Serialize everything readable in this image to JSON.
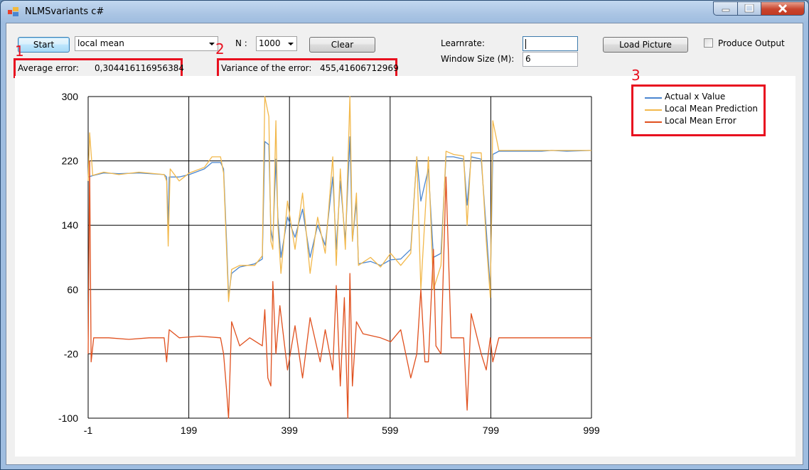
{
  "window": {
    "title": "NLMSvariants c#"
  },
  "toolbar": {
    "start_label": "Start",
    "mode_value": "local mean",
    "n_label": "N :",
    "n_value": "1000",
    "clear_label": "Clear",
    "learnrate_label": "Learnrate:",
    "learnrate_value": "",
    "window_size_label": "Window Size (M):",
    "window_size_value": "6",
    "load_picture_label": "Load Picture",
    "produce_output_label": "Produce Output",
    "produce_output_checked": false
  },
  "stats": {
    "avg_error_label": "Average error:",
    "avg_error_value": "0,304416116956384",
    "variance_label": "Variance of the error:",
    "variance_value": "455,41606712969"
  },
  "annotations": [
    "1",
    "2",
    "3"
  ],
  "colors": {
    "actual": "#4a86d0",
    "prediction": "#f2b84b",
    "error": "#e0501e",
    "highlight": "#e8101f"
  },
  "chart_data": {
    "type": "line",
    "title": "",
    "xlabel": "",
    "ylabel": "",
    "xlim": [
      -1,
      999
    ],
    "ylim": [
      -100,
      300
    ],
    "x_ticks": [
      "-1",
      "199",
      "399",
      "599",
      "799",
      "999"
    ],
    "y_ticks": [
      "300",
      "220",
      "140",
      "60",
      "-20",
      "-100"
    ],
    "grid": true,
    "legend_position": "right",
    "series": [
      {
        "name": "Actual x Value",
        "points": [
          [
            -1,
            200
          ],
          [
            10,
            202
          ],
          [
            30,
            205
          ],
          [
            60,
            204
          ],
          [
            100,
            205
          ],
          [
            150,
            203
          ],
          [
            155,
            200
          ],
          [
            158,
            140
          ],
          [
            160,
            200
          ],
          [
            180,
            200
          ],
          [
            200,
            203
          ],
          [
            230,
            210
          ],
          [
            245,
            218
          ],
          [
            262,
            218
          ],
          [
            268,
            210
          ],
          [
            274,
            120
          ],
          [
            278,
            52
          ],
          [
            284,
            80
          ],
          [
            300,
            88
          ],
          [
            330,
            92
          ],
          [
            345,
            98
          ],
          [
            350,
            244
          ],
          [
            358,
            240
          ],
          [
            362,
            135
          ],
          [
            366,
            120
          ],
          [
            372,
            222
          ],
          [
            376,
            150
          ],
          [
            382,
            100
          ],
          [
            395,
            150
          ],
          [
            410,
            125
          ],
          [
            425,
            160
          ],
          [
            440,
            100
          ],
          [
            455,
            140
          ],
          [
            470,
            115
          ],
          [
            485,
            200
          ],
          [
            492,
            110
          ],
          [
            500,
            195
          ],
          [
            510,
            120
          ],
          [
            519,
            250
          ],
          [
            524,
            120
          ],
          [
            532,
            170
          ],
          [
            536,
            92
          ],
          [
            560,
            95
          ],
          [
            580,
            90
          ],
          [
            600,
            97
          ],
          [
            620,
            98
          ],
          [
            640,
            110
          ],
          [
            652,
            225
          ],
          [
            660,
            170
          ],
          [
            675,
            210
          ],
          [
            685,
            100
          ],
          [
            700,
            105
          ],
          [
            710,
            225
          ],
          [
            725,
            225
          ],
          [
            745,
            222
          ],
          [
            752,
            165
          ],
          [
            760,
            225
          ],
          [
            780,
            222
          ],
          [
            790,
            135
          ],
          [
            798,
            60
          ],
          [
            803,
            228
          ],
          [
            815,
            232
          ],
          [
            830,
            232
          ],
          [
            850,
            232
          ],
          [
            870,
            232
          ],
          [
            880,
            232
          ],
          [
            900,
            232
          ],
          [
            920,
            233
          ],
          [
            950,
            232
          ],
          [
            999,
            233
          ]
        ]
      },
      {
        "name": "Local Mean Prediction",
        "points": [
          [
            -1,
            195
          ],
          [
            2,
            255
          ],
          [
            8,
            202
          ],
          [
            30,
            206
          ],
          [
            60,
            203
          ],
          [
            100,
            206
          ],
          [
            150,
            203
          ],
          [
            155,
            195
          ],
          [
            158,
            114
          ],
          [
            162,
            210
          ],
          [
            180,
            195
          ],
          [
            200,
            205
          ],
          [
            230,
            212
          ],
          [
            245,
            225
          ],
          [
            262,
            225
          ],
          [
            268,
            205
          ],
          [
            274,
            110
          ],
          [
            278,
            45
          ],
          [
            284,
            85
          ],
          [
            300,
            90
          ],
          [
            330,
            90
          ],
          [
            345,
            102
          ],
          [
            350,
            300
          ],
          [
            358,
            275
          ],
          [
            362,
            120
          ],
          [
            366,
            110
          ],
          [
            372,
            270
          ],
          [
            376,
            140
          ],
          [
            382,
            80
          ],
          [
            395,
            170
          ],
          [
            410,
            110
          ],
          [
            425,
            180
          ],
          [
            440,
            80
          ],
          [
            455,
            150
          ],
          [
            470,
            105
          ],
          [
            485,
            225
          ],
          [
            492,
            90
          ],
          [
            500,
            210
          ],
          [
            510,
            110
          ],
          [
            519,
            300
          ],
          [
            524,
            120
          ],
          [
            532,
            180
          ],
          [
            536,
            90
          ],
          [
            560,
            100
          ],
          [
            580,
            88
          ],
          [
            600,
            105
          ],
          [
            620,
            90
          ],
          [
            640,
            105
          ],
          [
            652,
            225
          ],
          [
            660,
            60
          ],
          [
            675,
            225
          ],
          [
            685,
            60
          ],
          [
            700,
            90
          ],
          [
            710,
            232
          ],
          [
            725,
            228
          ],
          [
            745,
            226
          ],
          [
            752,
            140
          ],
          [
            760,
            230
          ],
          [
            780,
            230
          ],
          [
            790,
            120
          ],
          [
            798,
            50
          ],
          [
            803,
            270
          ],
          [
            815,
            233
          ],
          [
            830,
            233
          ],
          [
            850,
            233
          ],
          [
            870,
            233
          ],
          [
            880,
            233
          ],
          [
            900,
            233
          ],
          [
            920,
            233
          ],
          [
            950,
            233
          ],
          [
            999,
            233
          ]
        ]
      },
      {
        "name": "Local Mean Error",
        "points": [
          [
            -1,
            -20
          ],
          [
            2,
            220
          ],
          [
            5,
            -30
          ],
          [
            10,
            0
          ],
          [
            40,
            0
          ],
          [
            80,
            -2
          ],
          [
            120,
            0
          ],
          [
            150,
            0
          ],
          [
            155,
            -30
          ],
          [
            160,
            10
          ],
          [
            180,
            0
          ],
          [
            220,
            2
          ],
          [
            262,
            0
          ],
          [
            268,
            -20
          ],
          [
            274,
            -65
          ],
          [
            278,
            -100
          ],
          [
            284,
            20
          ],
          [
            300,
            -10
          ],
          [
            320,
            0
          ],
          [
            345,
            -10
          ],
          [
            350,
            35
          ],
          [
            356,
            -50
          ],
          [
            362,
            -60
          ],
          [
            366,
            70
          ],
          [
            372,
            -20
          ],
          [
            380,
            40
          ],
          [
            395,
            -40
          ],
          [
            410,
            15
          ],
          [
            425,
            -50
          ],
          [
            440,
            25
          ],
          [
            460,
            -30
          ],
          [
            470,
            10
          ],
          [
            485,
            -40
          ],
          [
            492,
            65
          ],
          [
            500,
            -60
          ],
          [
            508,
            50
          ],
          [
            515,
            -100
          ],
          [
            519,
            80
          ],
          [
            524,
            -60
          ],
          [
            532,
            20
          ],
          [
            545,
            5
          ],
          [
            580,
            0
          ],
          [
            600,
            -5
          ],
          [
            620,
            10
          ],
          [
            640,
            -50
          ],
          [
            652,
            -20
          ],
          [
            660,
            60
          ],
          [
            668,
            -30
          ],
          [
            675,
            -30
          ],
          [
            685,
            110
          ],
          [
            690,
            -10
          ],
          [
            700,
            -20
          ],
          [
            710,
            200
          ],
          [
            720,
            0
          ],
          [
            745,
            0
          ],
          [
            752,
            -90
          ],
          [
            760,
            30
          ],
          [
            780,
            -20
          ],
          [
            790,
            -40
          ],
          [
            798,
            0
          ],
          [
            803,
            -30
          ],
          [
            815,
            0
          ],
          [
            850,
            0
          ],
          [
            900,
            0
          ],
          [
            950,
            0
          ],
          [
            999,
            0
          ]
        ]
      }
    ]
  }
}
